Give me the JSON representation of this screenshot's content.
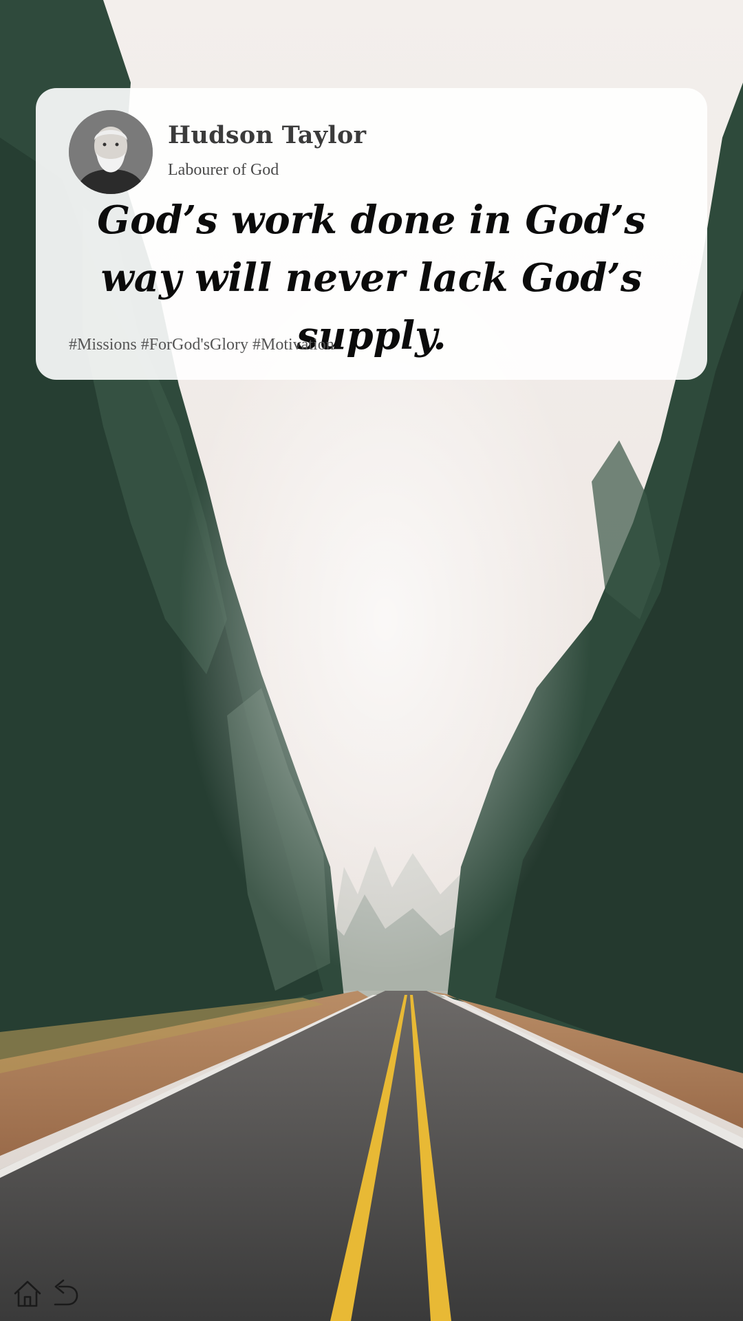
{
  "author": {
    "name": "Hudson Taylor",
    "role": "Labourer of God",
    "avatar_icon": "portrait-avatar"
  },
  "quote": {
    "text": "God’s work done in God’s way will never lack God’s supply."
  },
  "hashtags": "#Missions #ForGod'sGlory #Motivation",
  "nav": {
    "home_icon": "home-icon",
    "back_icon": "back-arrow-icon"
  },
  "colors": {
    "card": "#ffffff",
    "text_dark": "#0b0b0b",
    "road_line_yellow": "#e8b935",
    "forest_green": "#2f4a3c",
    "fog": "#f4efeb"
  }
}
